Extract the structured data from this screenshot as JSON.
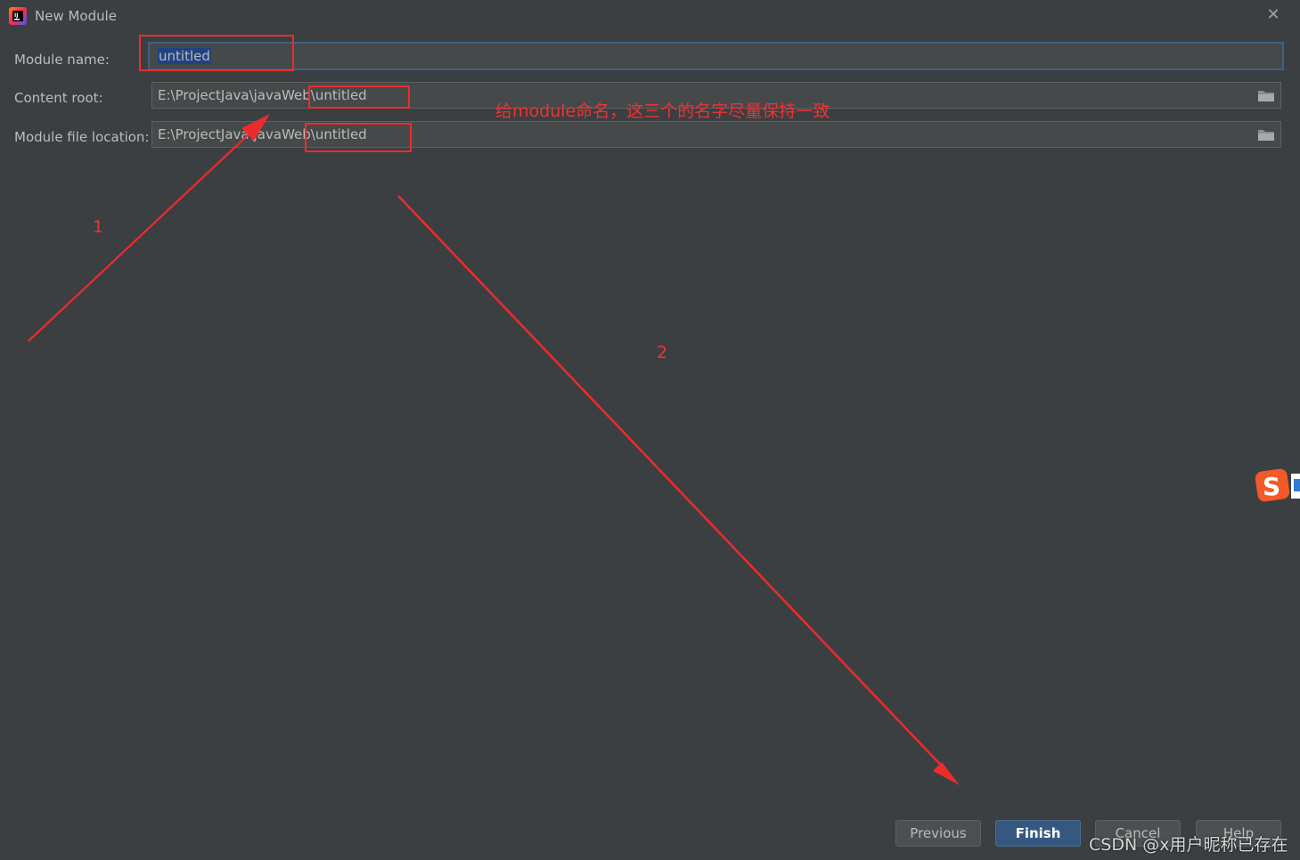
{
  "window": {
    "title": "New Module",
    "close_icon": "close-icon"
  },
  "form": {
    "module_name": {
      "label": "Module name:",
      "value": "untitled"
    },
    "content_root": {
      "label": "Content root:",
      "prefix": "E:\\ProjectJava\\javaWeb",
      "suffix": "\\untitled"
    },
    "module_file_location": {
      "label": "Module file location:",
      "prefix": "E:\\ProjectJava\\javaWeb",
      "suffix": "\\untitled"
    }
  },
  "buttons": {
    "previous": "Previous",
    "finish": "Finish",
    "cancel": "Cancel",
    "help": "Help"
  },
  "annotations": {
    "note": "给module命名，这三个的名字尽量保持一致",
    "step1": "1",
    "step2": "2"
  },
  "watermark": "CSDN @x用户昵称已存在",
  "colors": {
    "accent": "#365880",
    "annotation": "#ee2b2b",
    "background": "#3c3f41"
  }
}
